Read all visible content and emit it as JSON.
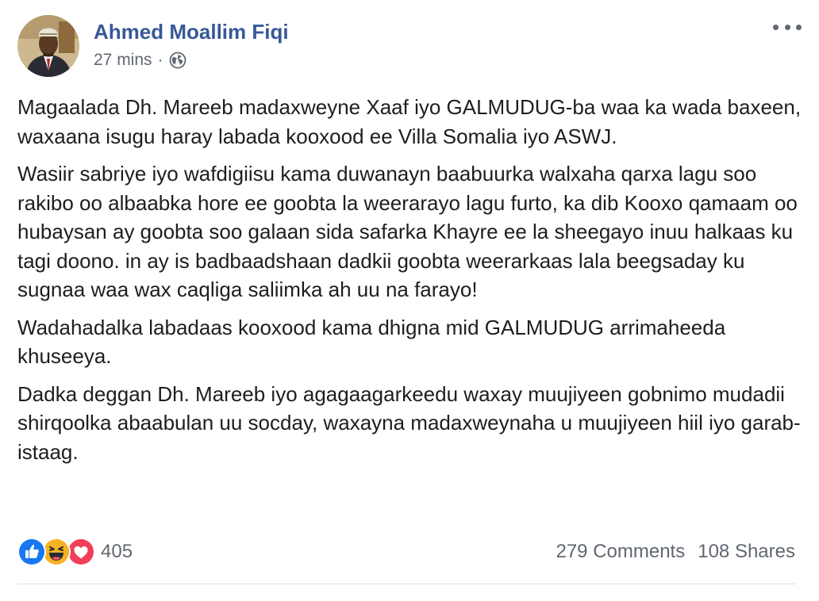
{
  "post": {
    "author": "Ahmed Moallim Fiqi",
    "time": "27 mins",
    "separator": "·",
    "audience_icon": "globe-icon",
    "menu_icon": "more-options-icon",
    "paragraphs": [
      "Magaalada Dh. Mareeb madaxweyne Xaaf iyo GALMUDUG-ba waa ka wada baxeen, waxaana isugu haray labada kooxood ee Villa Somalia iyo ASWJ.",
      "Wasiir sabriye iyo wafdigiisu kama duwanayn baabuurka walxaha qarxa lagu soo rakibo oo albaabka hore ee goobta la weerarayo lagu furto, ka dib Kooxo qamaam oo hubaysan ay goobta soo galaan sida safarka Khayre ee la sheegayo inuu halkaas ku tagi doono. in ay is badbaadshaan dadkii goobta weerarkaas lala beegsaday ku sugnaa waa wax caqliga saliimka ah uu na farayo!",
      "Wadahadalka labadaas kooxood kama dhigna mid GALMUDUG arrimaheeda khuseeya.",
      "Dadka deggan Dh. Mareeb iyo agagaagarkeedu waxay muujiyeen gobnimo mudadii shirqoolka abaabulan uu socday, waxayna madaxweynaha u muujiyeen hiil iyo garab-istaag."
    ]
  },
  "reactions": {
    "icons": [
      "like-icon",
      "haha-icon",
      "love-icon"
    ],
    "count": "405"
  },
  "stats": {
    "comments": "279 Comments",
    "shares": "108 Shares"
  },
  "colors": {
    "author": "#385898",
    "meta": "#606770",
    "like": "#1877f2",
    "haha": "#f7b125",
    "love": "#f33e58"
  }
}
